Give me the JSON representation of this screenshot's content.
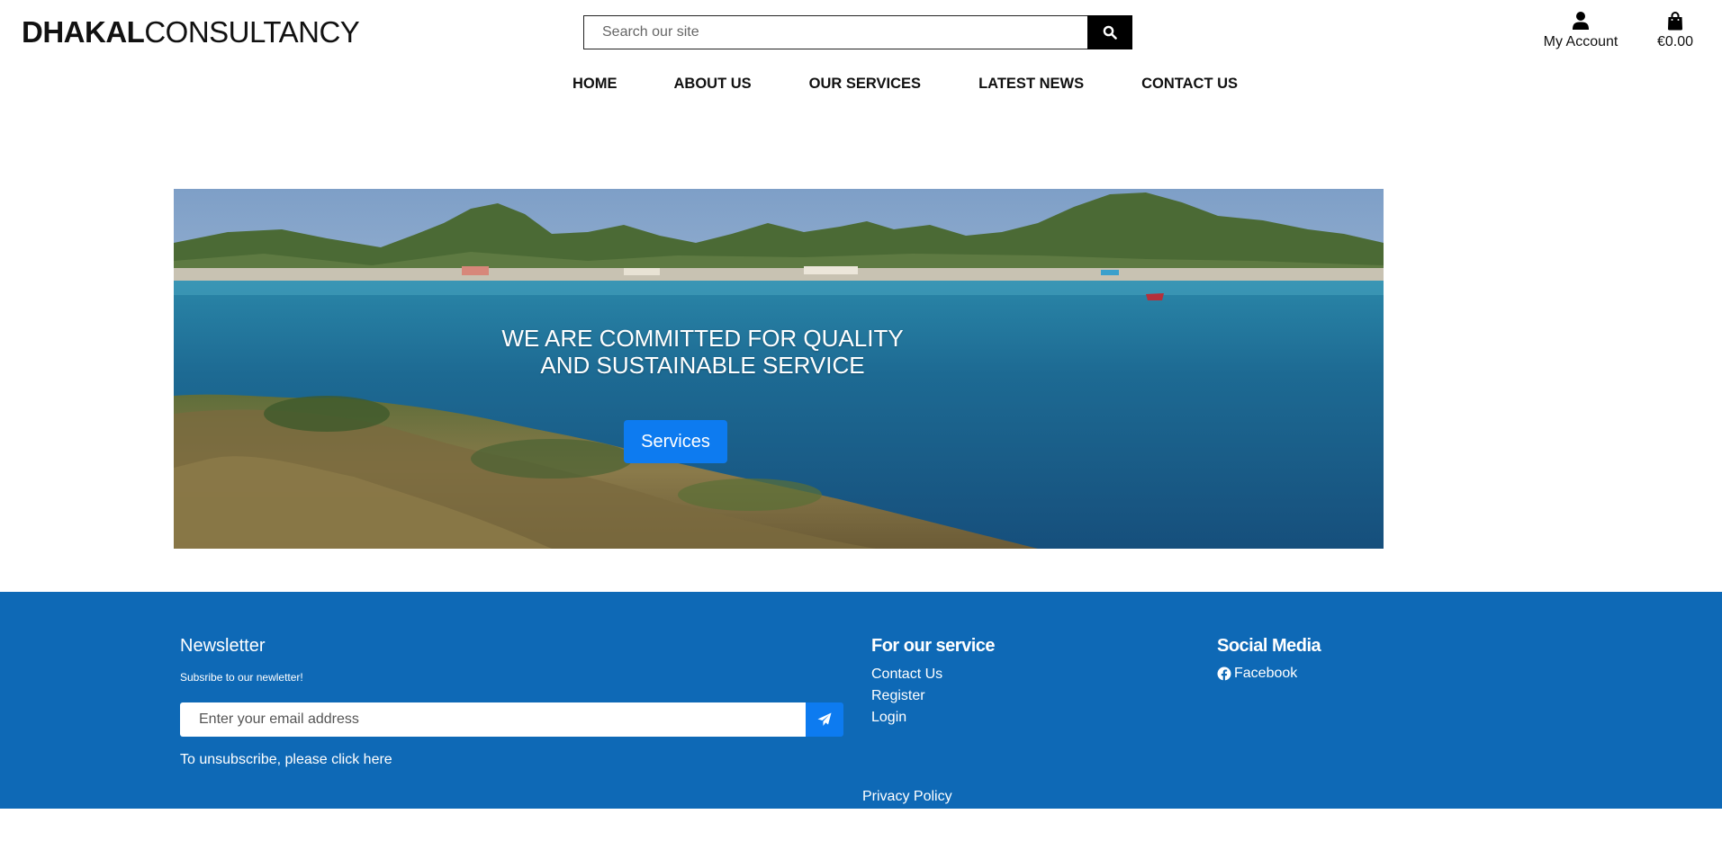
{
  "header": {
    "logo_bold": "DHAKAL",
    "logo_light": "CONSULTANCY",
    "search": {
      "placeholder": "Search our site",
      "icon": "search-icon"
    },
    "account": {
      "label": "My Account",
      "icon": "user-icon"
    },
    "cart": {
      "label": "€0.00",
      "icon": "shopping-bag-icon"
    }
  },
  "nav": {
    "items": [
      {
        "label": "HOME"
      },
      {
        "label": "ABOUT US"
      },
      {
        "label": "OUR SERVICES"
      },
      {
        "label": "LATEST NEWS"
      },
      {
        "label": "CONTACT US"
      }
    ]
  },
  "hero": {
    "title": "WE ARE COMMITTED FOR QUALITY AND SUSTAINABLE SERVICE",
    "button_label": "Services",
    "button_color": "#0d7bf0"
  },
  "footer": {
    "background_color": "#0e69b6",
    "newsletter": {
      "title": "Newsletter",
      "subtitle": "Subsribe to our newletter!",
      "email_placeholder": "Enter your email address",
      "send_icon": "paper-plane-icon",
      "unsubscribe_text": "To unsubscribe, please ",
      "unsubscribe_link": "click here"
    },
    "service": {
      "title": "For our service",
      "links": [
        "Contact Us",
        "Register",
        "Login"
      ]
    },
    "social": {
      "title": "Social Media",
      "facebook_label": "Facebook",
      "facebook_icon": "facebook-icon"
    },
    "privacy_label": "Privacy Policy"
  }
}
